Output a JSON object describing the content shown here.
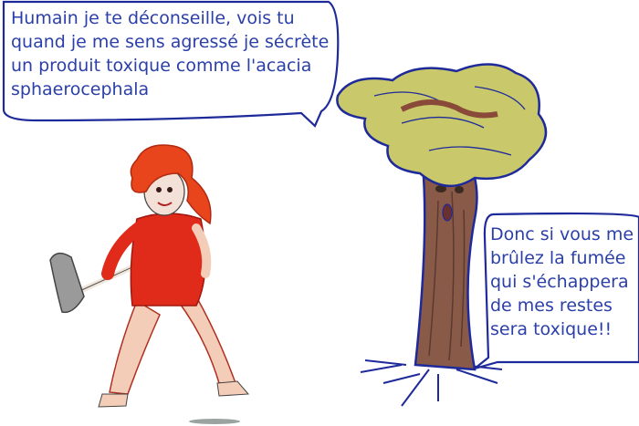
{
  "speech_bubbles": {
    "woman": "Humain je te déconseille, vois tu\nquand je me sens agressé je sécrète\nun produit toxique comme l'acacia\nsphaerocephala",
    "tree": "Donc si vous me\nbrûlez la fumée\nqui s'échappera\nde mes restes\nsera toxique!!"
  },
  "colors": {
    "bubble_outline": "#1e2a9a",
    "text": "#2b3fa8",
    "hair": "#e8451c",
    "dress": "#e02a1a",
    "foliage": "#c9c86a",
    "trunk": "#8a5a48"
  }
}
